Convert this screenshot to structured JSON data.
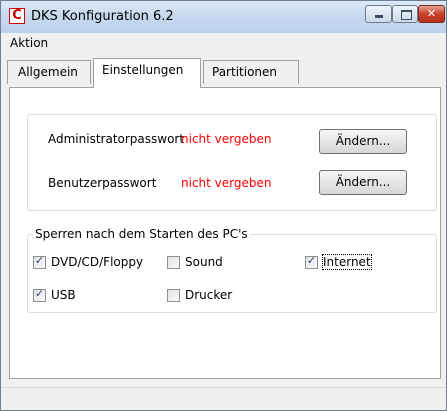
{
  "window": {
    "title": "DKS Konfiguration 6.2",
    "app_icon_letter": "C"
  },
  "menu": {
    "items": [
      {
        "label": "Aktion"
      }
    ]
  },
  "tabs": [
    {
      "label": "Allgemein"
    },
    {
      "label": "Einstellungen",
      "selected": true
    },
    {
      "label": "Partitionen"
    }
  ],
  "passwords": {
    "admin": {
      "label": "Administratorpasswort",
      "status": "nicht vergeben",
      "button": "Ändern..."
    },
    "user": {
      "label": "Benutzerpasswort",
      "status": "nicht vergeben",
      "button": "Ändern..."
    }
  },
  "locks": {
    "title": "Sperren nach dem Starten des PC's",
    "items": [
      {
        "label": "DVD/CD/Floppy",
        "checked": true
      },
      {
        "label": "Sound",
        "checked": false
      },
      {
        "label": "Internet",
        "checked": true
      },
      {
        "label": "USB",
        "checked": true
      },
      {
        "label": "Drucker",
        "checked": false
      }
    ]
  },
  "colors": {
    "status_red": "#ff0000",
    "titlebar": "#c6d8ee",
    "close_button": "#c8402a"
  }
}
